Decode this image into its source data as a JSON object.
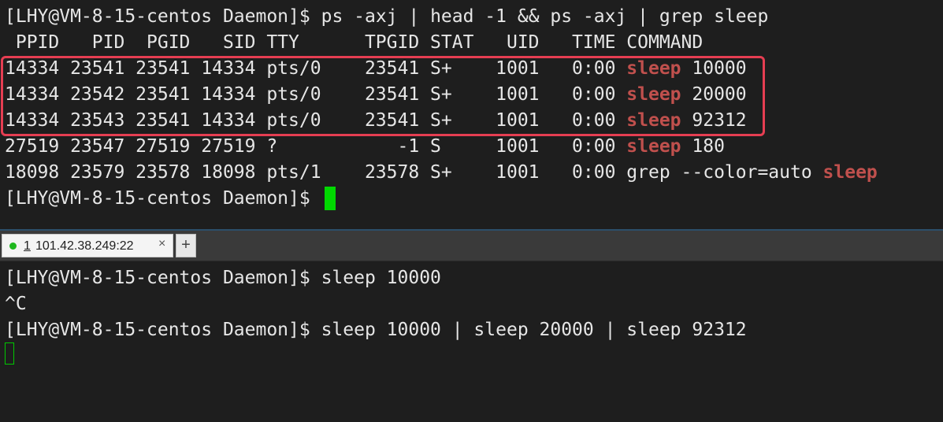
{
  "top_terminal": {
    "prompt": "[LHY@VM-8-15-centos Daemon]$",
    "command": "ps -axj | head -1 && ps -axj | grep sleep",
    "header": " PPID   PID  PGID   SID TTY      TPGID STAT   UID   TIME COMMAND",
    "rows": [
      {
        "prefix": "14334 23541 23541 14334 pts/0    23541 S+    1001   0:00 ",
        "match": "sleep",
        "suffix": " 10000"
      },
      {
        "prefix": "14334 23542 23541 14334 pts/0    23541 S+    1001   0:00 ",
        "match": "sleep",
        "suffix": " 20000"
      },
      {
        "prefix": "14334 23543 23541 14334 pts/0    23541 S+    1001   0:00 ",
        "match": "sleep",
        "suffix": " 92312"
      },
      {
        "prefix": "27519 23547 27519 27519 ?           -1 S     1001   0:00 ",
        "match": "sleep",
        "suffix": " 180"
      },
      {
        "prefix": "18098 23579 23578 18098 pts/1    23578 S+    1001   0:00 grep --color=auto ",
        "match": "sleep",
        "suffix": ""
      }
    ],
    "final_prompt": "[LHY@VM-8-15-centos Daemon]$ "
  },
  "tab": {
    "number": "1",
    "host": "101.42.38.249:22",
    "close": "×",
    "new_tab": "+"
  },
  "bottom_terminal": {
    "line1": "[LHY@VM-8-15-centos Daemon]$ sleep 10000",
    "line2": "^C",
    "line3": "[LHY@VM-8-15-centos Daemon]$ sleep 10000 | sleep 20000 | sleep 92312"
  },
  "colors": {
    "background": "#1e1e1e",
    "text": "#e6e6e6",
    "grep_match": "#c0504d",
    "highlight_box": "#e63e52",
    "cursor": "#00d800"
  }
}
